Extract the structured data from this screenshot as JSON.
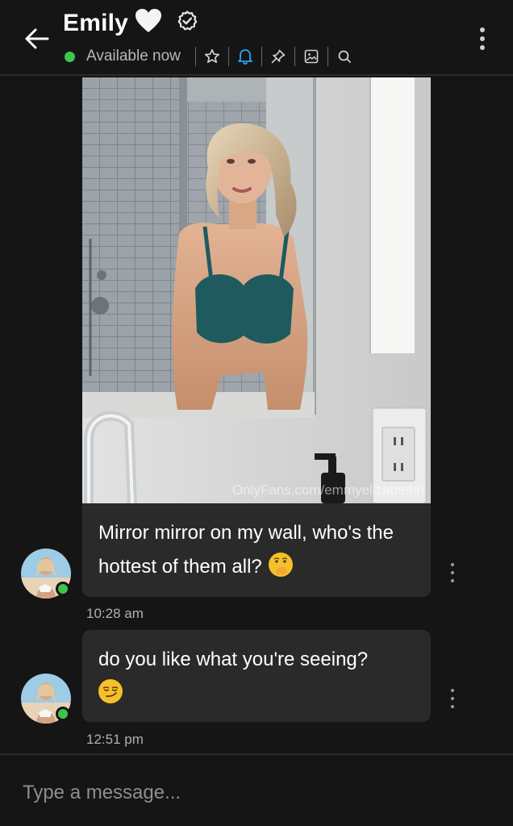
{
  "header": {
    "title": "Emily",
    "title_emoji_icon": "white-heart-icon",
    "verified_icon": "verified-badge-icon",
    "status": "Available now",
    "status_color": "#3ec44a",
    "toolbar_icons": [
      "star-icon",
      "bell-icon",
      "pin-icon",
      "image-icon",
      "search-icon"
    ],
    "accent_color": "#2aa4f4"
  },
  "messages": [
    {
      "type": "photo",
      "watermark": "OnlyFans.com/emmyelizabethh",
      "text": "Mirror mirror on my wall, who's the hottest of them all?",
      "emoji_icon": "face-with-hand-over-mouth-icon",
      "time": "10:28 am"
    },
    {
      "type": "text",
      "text": "do you like what you're seeing?",
      "emoji_icon": "smirking-face-icon",
      "time": "12:51 pm"
    }
  ],
  "composer": {
    "placeholder": "Type a message..."
  }
}
